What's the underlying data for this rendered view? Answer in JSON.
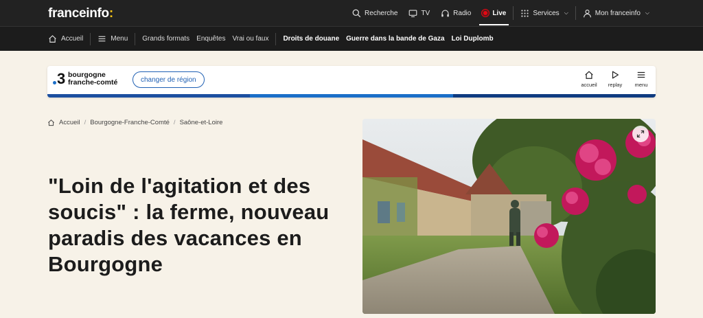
{
  "brand": {
    "name": "franceinfo",
    "accent": ":",
    "accent_color": "#f5c518"
  },
  "topnav": {
    "search": "Recherche",
    "tv": "TV",
    "radio": "Radio",
    "live": "Live",
    "services": "Services",
    "account": "Mon franceinfo"
  },
  "subnav": {
    "home": "Accueil",
    "menu": "Menu",
    "links": [
      "Grands formats",
      "Enquêtes",
      "Vrai ou faux"
    ],
    "highlights": [
      "Droits de douane",
      "Guerre dans la bande de Gaza",
      "Loi Duplomb"
    ]
  },
  "region": {
    "number": "3",
    "name_line1": "bourgogne",
    "name_line2": "franche-comté",
    "change_button": "changer de région",
    "actions": [
      "accueil",
      "replay",
      "menu"
    ],
    "stripe_colors": [
      "#1c4fa0",
      "#1a6ec8",
      "#0f3b80"
    ]
  },
  "breadcrumb": [
    "Accueil",
    "Bourgogne-Franche-Comté",
    "Saône-et-Loire"
  ],
  "article": {
    "title": "\"Loin de l'agitation et des soucis\" : la ferme, nouveau paradis des vacances en Bourgogne"
  }
}
